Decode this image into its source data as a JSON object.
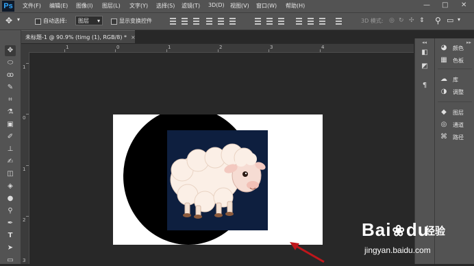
{
  "app": {
    "logo": "Ps"
  },
  "menubar": {
    "items": [
      "文件(F)",
      "编辑(E)",
      "图像(I)",
      "图层(L)",
      "文字(Y)",
      "选择(S)",
      "滤镜(T)",
      "3D(D)",
      "视图(V)",
      "窗口(W)",
      "帮助(H)"
    ],
    "window_controls": {
      "minimize": "—",
      "restore": "□",
      "close": "✕"
    }
  },
  "options": {
    "auto_select_label": "自动选择:",
    "auto_select_value": "图层",
    "show_transform_label": "显示变换控件",
    "mode_3d_label": "3D 模式:"
  },
  "document": {
    "tab_title": "未标题-1 @ 90.9% (timg (1), RGB/8) *",
    "tab_close": "×"
  },
  "rulers": {
    "horizontal": [
      "1",
      "0",
      "1",
      "2",
      "3",
      "4"
    ],
    "vertical": [
      "1",
      "0",
      "1",
      "2",
      "3"
    ]
  },
  "panels": {
    "items": [
      {
        "label": "颜色",
        "icon": "palette-icon"
      },
      {
        "label": "色板",
        "icon": "swatches-icon"
      },
      {
        "label": "库",
        "icon": "libraries-icon"
      },
      {
        "label": "调整",
        "icon": "adjustments-icon"
      },
      {
        "label": "图层",
        "icon": "layers-icon"
      },
      {
        "label": "通道",
        "icon": "channels-icon"
      },
      {
        "label": "路径",
        "icon": "paths-icon"
      }
    ]
  },
  "watermark": {
    "brand_left": "Bai",
    "brand_right": "du",
    "brand_cn": "经验",
    "url": "jingyan.baidu.com"
  },
  "colors": {
    "ui_panel": "#535353",
    "workspace": "#282828",
    "document": "#ffffff",
    "circle": "#000000",
    "sheep_bg": "#0e1f3f",
    "arrow": "#c0161b"
  }
}
